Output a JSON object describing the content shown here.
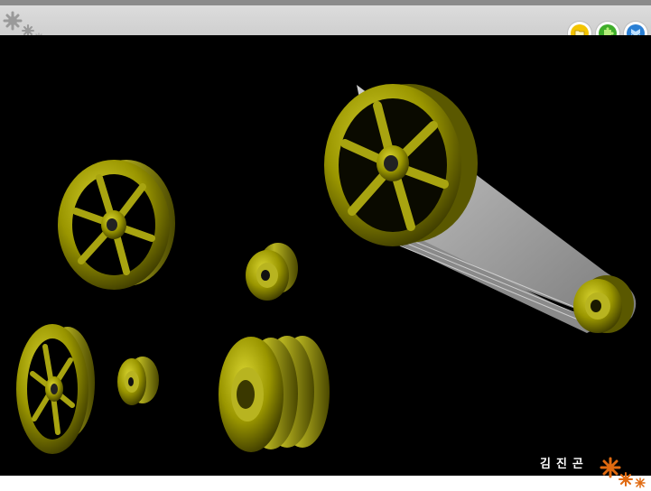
{
  "author": {
    "name": "김진곤"
  },
  "nav": {
    "buttons": [
      {
        "icon": "folder-icon"
      },
      {
        "icon": "puzzle-icon"
      },
      {
        "icon": "share-icon"
      }
    ]
  },
  "colors": {
    "pulley": "#9a9800",
    "pulley_dark": "#4a4800",
    "belt": "#a9a9a9",
    "background": "#000000",
    "header": "#d4d4d4",
    "accent": "#e06a10"
  }
}
